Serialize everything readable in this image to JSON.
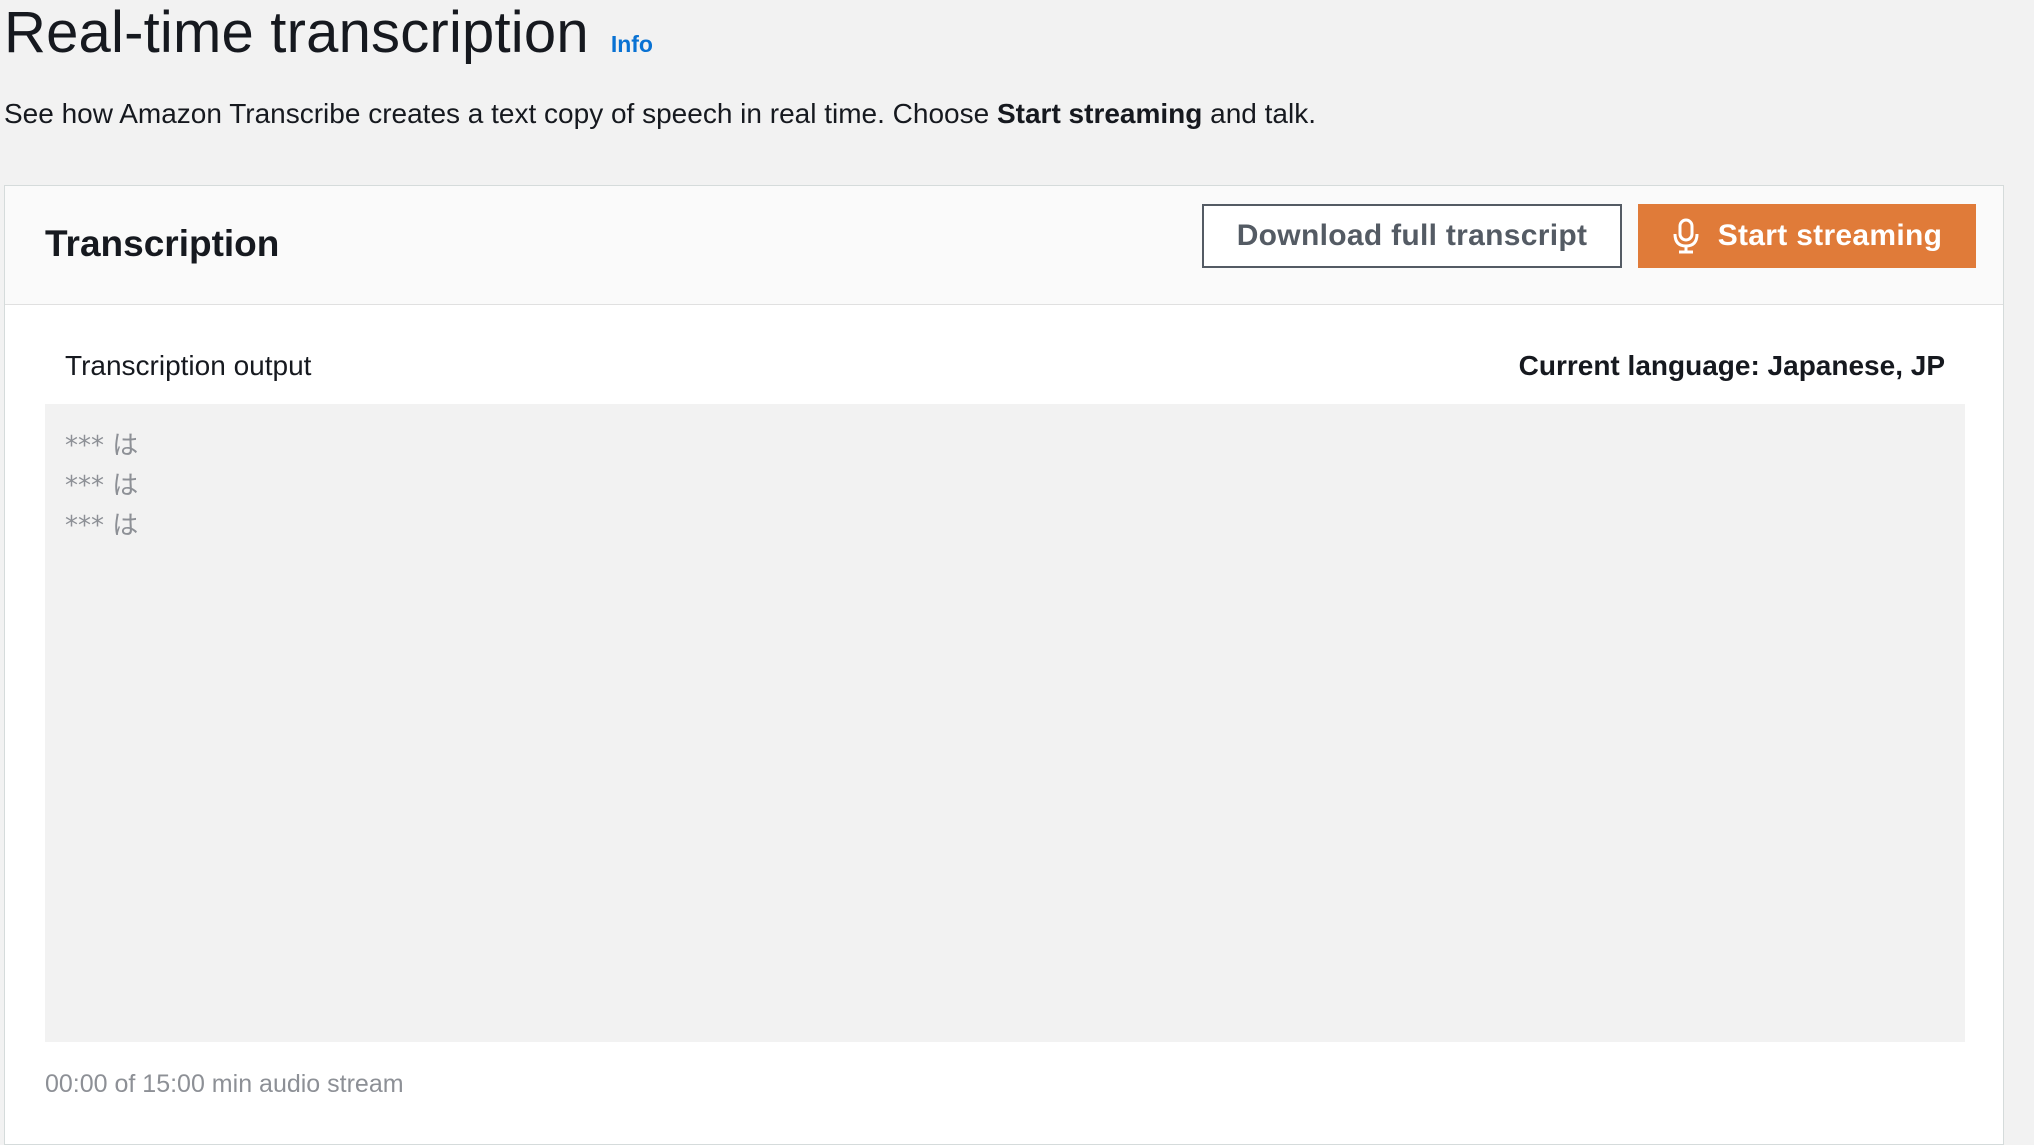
{
  "header": {
    "title": "Real-time transcription",
    "info_link": "Info",
    "description_prefix": "See how Amazon Transcribe creates a text copy of speech in real time. Choose ",
    "description_strong": "Start streaming",
    "description_suffix": " and talk."
  },
  "panel": {
    "title": "Transcription",
    "download_button": "Download full transcript",
    "start_button": "Start streaming",
    "start_button_icon": "microphone-icon",
    "output_label": "Transcription output",
    "current_language": "Current language: Japanese, JP",
    "transcript_lines": [
      "*** は",
      "*** は",
      "*** は"
    ],
    "stream_status": "00:00 of 15:00 min audio stream"
  },
  "colors": {
    "primary_button": "#e07b39",
    "info_link": "#0972d3",
    "page_background": "#f2f2f2",
    "muted_text": "#8d9096"
  }
}
